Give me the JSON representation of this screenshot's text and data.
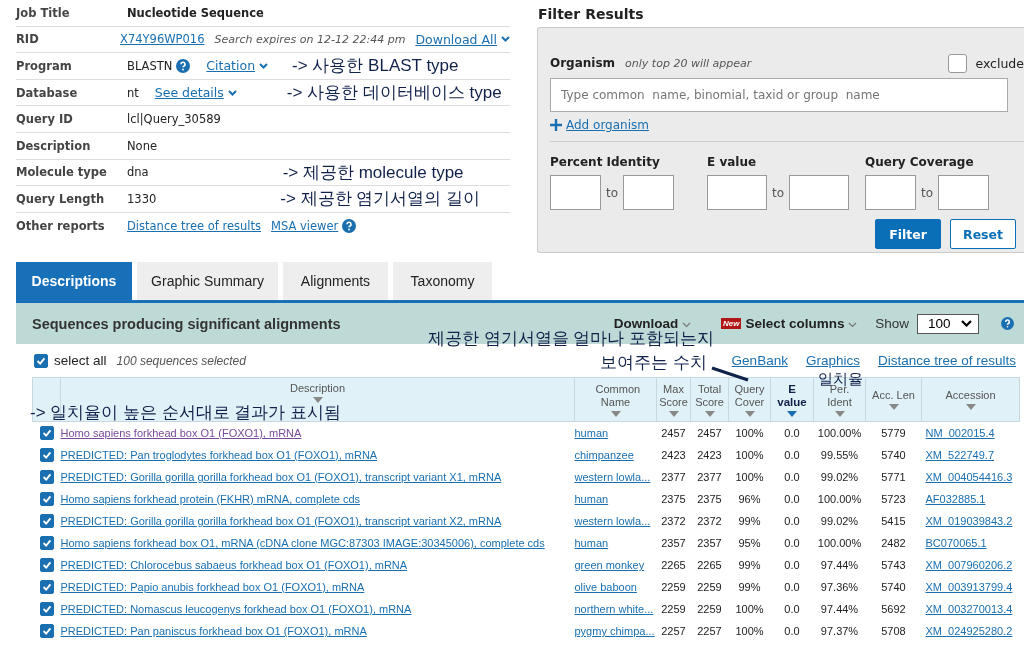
{
  "summary": {
    "rows": [
      {
        "label": "Job Title",
        "kind": "bold",
        "value": "Nucleotide Sequence"
      },
      {
        "label": "RID",
        "kind": "rid",
        "link": "X74Y96WP016",
        "note_italic": "Search expires on 12-12 22:44 pm",
        "dropdown": "Download All"
      },
      {
        "label": "Program",
        "kind": "program",
        "value": "BLASTN",
        "dropdown": "Citation",
        "annotation": "-> 사용한 BLAST type"
      },
      {
        "label": "Database",
        "kind": "program",
        "value": "nt",
        "dropdown": "See details",
        "annotation": "-> 사용한 데이터베이스 type"
      },
      {
        "label": "Query ID",
        "kind": "plain",
        "value": "lcl|Query_30589"
      },
      {
        "label": "Description",
        "kind": "plain",
        "value": "None"
      },
      {
        "label": "Molecule type",
        "kind": "plain",
        "value": "dna",
        "annotation": "-> 제공한 molecule type"
      },
      {
        "label": "Query Length",
        "kind": "plain",
        "value": "1330",
        "annotation": "-> 제공한 염기서열의 길이"
      },
      {
        "label": "Other reports",
        "kind": "links",
        "links": [
          "Distance tree of results",
          "MSA viewer"
        ]
      }
    ]
  },
  "filter": {
    "title": "Filter Results",
    "organism_label": "Organism",
    "organism_hint": "only top 20 will appear",
    "exclude": {
      "label": "exclude",
      "checked": false
    },
    "placeholder": "Type common  name, binomial, taxid or group  name",
    "add": "Add organism",
    "ranges": [
      {
        "label": "Percent Identity",
        "to": "to"
      },
      {
        "label": "E value",
        "to": "to"
      },
      {
        "label": "Query Coverage",
        "to": "to"
      }
    ],
    "buttons": [
      "Filter",
      "Reset"
    ]
  },
  "tabs": [
    {
      "label": "Descriptions",
      "selected": true
    },
    {
      "label": "Graphic Summary",
      "selected": false
    },
    {
      "label": "Alignments",
      "selected": false
    },
    {
      "label": "Taxonomy",
      "selected": false
    }
  ],
  "results": {
    "title": "Sequences producing significant alignments",
    "download": "Download",
    "new_badge": "New",
    "select_columns": "Select columns",
    "show_label": "Show",
    "show_value": "100",
    "select_all": {
      "label": "select all",
      "checked": true
    },
    "selected_count": "100 sequences selected",
    "links": [
      "GenBank",
      "Graphics",
      "Distance tree of results"
    ],
    "columns": [
      {
        "label": "Description",
        "sorted": false
      },
      {
        "label": "Common Name",
        "sorted": false
      },
      {
        "label": "Max Score",
        "sorted": false
      },
      {
        "label": "Total Score",
        "sorted": false
      },
      {
        "label": "Query Cover",
        "sorted": false
      },
      {
        "label": "E value",
        "sorted": true
      },
      {
        "label": "Per. Ident",
        "sorted": false
      },
      {
        "label": "Acc. Len",
        "sorted": false
      },
      {
        "label": "Accession",
        "sorted": false
      }
    ],
    "rows": [
      {
        "checked": true,
        "visited": true,
        "cells": [
          "Homo sapiens forkhead box O1 (FOXO1), mRNA",
          "human",
          "2457",
          "2457",
          "100%",
          "0.0",
          "100.00%",
          "5779",
          "NM_002015.4"
        ]
      },
      {
        "checked": true,
        "visited": false,
        "cells": [
          "PREDICTED: Pan troglodytes forkhead box O1 (FOXO1), mRNA",
          "chimpanzee",
          "2423",
          "2423",
          "100%",
          "0.0",
          "99.55%",
          "5740",
          "XM_522749.7"
        ]
      },
      {
        "checked": true,
        "visited": false,
        "cells": [
          "PREDICTED: Gorilla gorilla gorilla forkhead box O1 (FOXO1), transcript variant X1, mRNA",
          "western lowla...",
          "2377",
          "2377",
          "100%",
          "0.0",
          "99.02%",
          "5771",
          "XM_004054416.3"
        ]
      },
      {
        "checked": true,
        "visited": false,
        "cells": [
          "Homo sapiens forkhead protein (FKHR) mRNA, complete cds",
          "human",
          "2375",
          "2375",
          "96%",
          "0.0",
          "100.00%",
          "5723",
          "AF032885.1"
        ]
      },
      {
        "checked": true,
        "visited": false,
        "cells": [
          "PREDICTED: Gorilla gorilla gorilla forkhead box O1 (FOXO1), transcript variant X2, mRNA",
          "western lowla...",
          "2372",
          "2372",
          "99%",
          "0.0",
          "99.02%",
          "5415",
          "XM_019039843.2"
        ]
      },
      {
        "checked": true,
        "visited": false,
        "cells": [
          "Homo sapiens forkhead box O1, mRNA (cDNA clone MGC:87303 IMAGE:30345006), complete cds",
          "human",
          "2357",
          "2357",
          "95%",
          "0.0",
          "100.00%",
          "2482",
          "BC070065.1"
        ]
      },
      {
        "checked": true,
        "visited": false,
        "cells": [
          "PREDICTED: Chlorocebus sabaeus forkhead box O1 (FOXO1), mRNA",
          "green monkey",
          "2265",
          "2265",
          "99%",
          "0.0",
          "97.44%",
          "5743",
          "XM_007960206.2"
        ]
      },
      {
        "checked": true,
        "visited": false,
        "cells": [
          "PREDICTED: Papio anubis forkhead box O1 (FOXO1), mRNA",
          "olive baboon",
          "2259",
          "2259",
          "99%",
          "0.0",
          "97.36%",
          "5740",
          "XM_003913799.4"
        ]
      },
      {
        "checked": true,
        "visited": false,
        "cells": [
          "PREDICTED: Nomascus leucogenys forkhead box O1 (FOXO1), mRNA",
          "northern white...",
          "2259",
          "2259",
          "100%",
          "0.0",
          "97.44%",
          "5692",
          "XM_003270013.4"
        ]
      },
      {
        "checked": true,
        "visited": false,
        "cells": [
          "PREDICTED: Pan paniscus forkhead box O1 (FOXO1), mRNA",
          "pygmy chimpa...",
          "2257",
          "2257",
          "100%",
          "0.0",
          "97.37%",
          "5708",
          "XM_024925280.2"
        ]
      }
    ]
  },
  "annotations": {
    "query_cover": [
      "제공한 염기서열을 얼마나 포함되는지",
      "보여주는 수치"
    ],
    "identity": "일치율",
    "order": "-> 일치율이 높은 순서대로 결과가 표시됨"
  }
}
